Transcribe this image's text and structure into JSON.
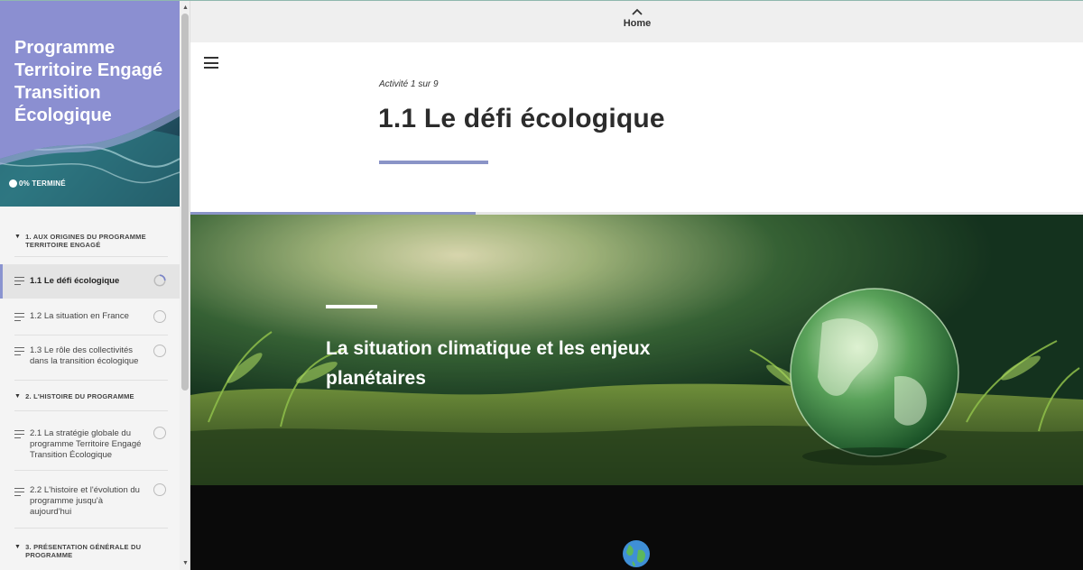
{
  "sidebar": {
    "course_title": "Programme Territoire Engagé Transition Écologique",
    "progress_text": "0% TERMINÉ",
    "progress_fraction": 0,
    "sections": [
      {
        "label": "1. AUX ORIGINES DU PROGRAMME TERRITOIRE ENGAGÉ"
      },
      {
        "label": "2. L'HISTOIRE DU PROGRAMME"
      },
      {
        "label": "3. PRÉSENTATION GÉNÉRALE DU PROGRAMME"
      }
    ],
    "lessons": [
      {
        "label": "1.1 Le défi écologique",
        "active": true
      },
      {
        "label": "1.2 La situation en France",
        "active": false
      },
      {
        "label": "1.3 Le rôle des collectivités dans la transition écologique",
        "active": false
      },
      {
        "label": "2.1 La stratégie globale du programme Territoire Engagé Transition Écologique",
        "active": false
      },
      {
        "label": "2.2 L'histoire et l'évolution du programme jusqu'à aujourd'hui",
        "active": false
      }
    ]
  },
  "topbar": {
    "home_label": "Home"
  },
  "main": {
    "activity_count": "Activité 1 sur 9",
    "lesson_title": "1.1 Le défi écologique",
    "lesson_progress_fraction": 0.32,
    "hero_title": "La situation climatique et les enjeux planétaires"
  },
  "colors": {
    "accent": "#8a94c7",
    "header_purple": "#8b8fd1",
    "dark_block": "#0a0a0a"
  }
}
